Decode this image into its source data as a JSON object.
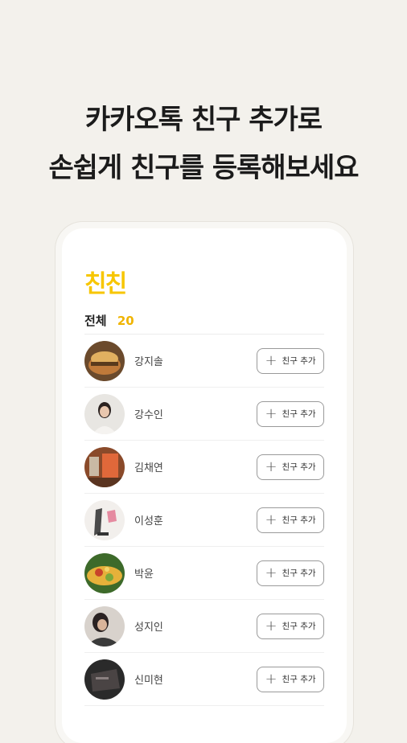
{
  "headline": {
    "line1": "카카오톡 친구 추가로",
    "line2": "손쉽게 친구를 등록해보세요"
  },
  "app": {
    "logo": "친친",
    "total_label": "전체",
    "total_count": "20",
    "add_button_label": "친구 추가",
    "add_icon": "+"
  },
  "friends": [
    {
      "name": "강지솔"
    },
    {
      "name": "강수인"
    },
    {
      "name": "김채연"
    },
    {
      "name": "이성훈"
    },
    {
      "name": "박윤"
    },
    {
      "name": "성지인"
    },
    {
      "name": "신미현"
    }
  ],
  "colors": {
    "background": "#f3f1ec",
    "accent": "#f7c600"
  }
}
